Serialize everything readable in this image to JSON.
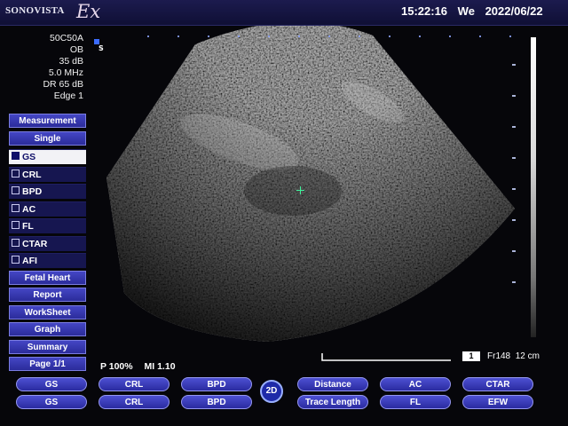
{
  "header": {
    "brand": "SONOVISTA",
    "brand_mark": "Ex",
    "time": "15:22:16",
    "weekday": "We",
    "date": "2022/06/22"
  },
  "params": [
    "50C50A",
    "OB",
    "35 dB",
    "5.0 MHz",
    "DR 65 dB",
    "Edge 1"
  ],
  "sidebar": {
    "header": "Measurement",
    "mode": "Single",
    "options": [
      {
        "label": "GS",
        "selected": true
      },
      {
        "label": "CRL",
        "selected": false
      },
      {
        "label": "BPD",
        "selected": false
      },
      {
        "label": "AC",
        "selected": false
      },
      {
        "label": "FL",
        "selected": false
      },
      {
        "label": "CTAR",
        "selected": false
      },
      {
        "label": "AFI",
        "selected": false
      }
    ],
    "buttons": [
      "Fetal Heart",
      "Report",
      "WorkSheet",
      "Graph",
      "Summary",
      "Page 1/1"
    ]
  },
  "image_info": {
    "frame_badge": "1",
    "frame": "Fr148",
    "depth": "12 cm",
    "power": "P 100%",
    "mi": "MI 1.10"
  },
  "mode_badge": "2D",
  "softkeys_row1": [
    "GS",
    "CRL",
    "BPD",
    "Distance",
    "AC",
    "CTAR"
  ],
  "softkeys_row2": [
    "GS",
    "CRL",
    "BPD",
    "Trace Length",
    "FL",
    "EFW"
  ],
  "colors": {
    "accent": "#2b2c9a",
    "selected_bg": "#f2f2f6",
    "caliper": "#3ff29b"
  }
}
